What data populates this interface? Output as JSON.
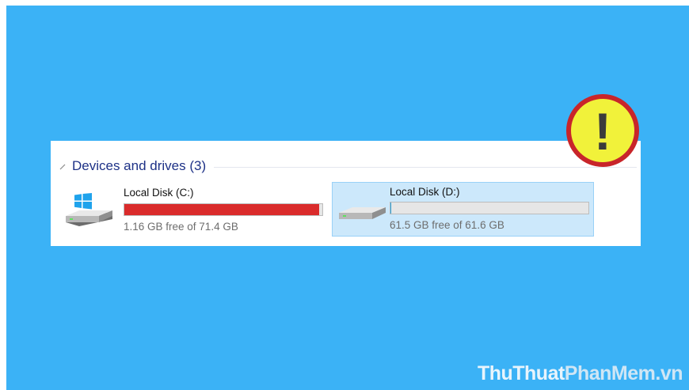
{
  "colors": {
    "background": "#3bb2f6",
    "section_title": "#1e3287",
    "bar_critical": "#da2b2b",
    "bar_track": "#e6e6e6",
    "selection": "#cce8fb",
    "warning_fill": "#f1f23a",
    "warning_ring": "#c8252a"
  },
  "section": {
    "title": "Devices and drives (3)",
    "icon": "chevron-collapse-icon"
  },
  "drives": [
    {
      "name": "Local Disk (C:)",
      "free_text": "1.16 GB free of 71.4 GB",
      "used_fraction": 0.984,
      "bar_color": "#da2b2b",
      "icon": "windows-drive-icon",
      "selected": false
    },
    {
      "name": "Local Disk (D:)",
      "free_text": "61.5 GB free of 61.6 GB",
      "used_fraction": 0.002,
      "bar_color": "#26a0da",
      "icon": "hard-drive-icon",
      "selected": true
    }
  ],
  "warning": {
    "icon": "exclamation-warning-icon",
    "symbol": "!"
  },
  "watermark": {
    "part1": "ThuThuat",
    "part2": "PhanMem.vn"
  }
}
